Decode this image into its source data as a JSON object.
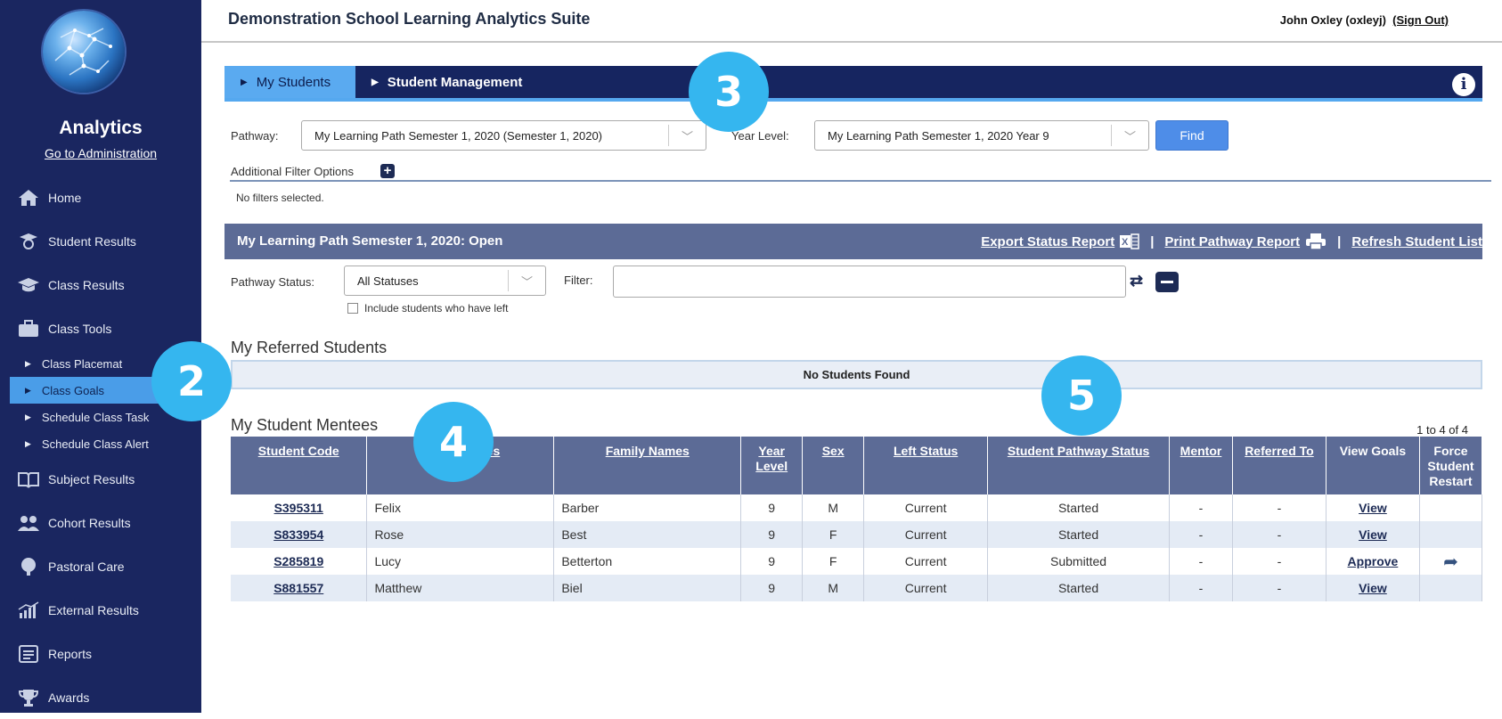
{
  "app": {
    "title": "Demonstration School Learning Analytics Suite",
    "user": "John Oxley (oxleyj)",
    "sign_out": "(Sign Out)"
  },
  "sidebar": {
    "brand": "Analytics",
    "admin_link": "Go to Administration",
    "items": [
      {
        "label": "Home",
        "icon": "home-icon"
      },
      {
        "label": "Student Results",
        "icon": "graduate-icon"
      },
      {
        "label": "Class Results",
        "icon": "mortarboard-icon"
      },
      {
        "label": "Class Tools",
        "icon": "briefcase-icon"
      }
    ],
    "subitems": [
      {
        "label": "Class Placemat"
      },
      {
        "label": "Class Goals"
      },
      {
        "label": "Schedule Class Task"
      },
      {
        "label": "Schedule Class Alert"
      }
    ],
    "items2": [
      {
        "label": "Subject Results",
        "icon": "book-icon"
      },
      {
        "label": "Cohort Results",
        "icon": "group-icon"
      },
      {
        "label": "Pastoral Care",
        "icon": "tree-icon"
      },
      {
        "label": "External Results",
        "icon": "chart-icon"
      },
      {
        "label": "Reports",
        "icon": "report-icon"
      },
      {
        "label": "Awards",
        "icon": "trophy-icon"
      }
    ]
  },
  "tabs": [
    "My Students",
    "Student Management"
  ],
  "filters": {
    "pathway_label": "Pathway:",
    "pathway_value": "My Learning Path Semester 1, 2020 (Semester 1, 2020)",
    "year_label": "Year Level:",
    "year_value": "My Learning Path Semester 1, 2020 Year 9",
    "find": "Find",
    "additional": "Additional Filter Options",
    "none": "No filters selected."
  },
  "pathway": {
    "title": "My Learning Path Semester 1, 2020:  Open",
    "export": "Export Status Report",
    "print": "Print Pathway Report",
    "refresh": "Refresh Student List",
    "status_label": "Pathway Status:",
    "status_value": "All Statuses",
    "filter_label": "Filter:",
    "include_left": "Include students who have left"
  },
  "referred": {
    "heading": "My Referred Students",
    "empty": "No Students Found"
  },
  "mentees": {
    "heading": "My Student Mentees",
    "count": "1 to 4 of 4",
    "columns": [
      "Student Code",
      "Given Names",
      "Family Names",
      "Year Level",
      "Sex",
      "Left Status",
      "Student Pathway Status",
      "Mentor",
      "Referred To",
      "View Goals",
      "Force Student Restart"
    ],
    "rows": [
      [
        "S395311",
        "Felix",
        "Barber",
        "9",
        "M",
        "Current",
        "Started",
        "-",
        "-",
        "View",
        ""
      ],
      [
        "S833954",
        "Rose",
        "Best",
        "9",
        "F",
        "Current",
        "Started",
        "-",
        "-",
        "View",
        ""
      ],
      [
        "S285819",
        "Lucy",
        "Betterton",
        "9",
        "F",
        "Current",
        "Submitted",
        "-",
        "-",
        "Approve",
        "restart"
      ],
      [
        "S881557",
        "Matthew",
        "Biel",
        "9",
        "M",
        "Current",
        "Started",
        "-",
        "-",
        "View",
        ""
      ]
    ]
  },
  "callouts": [
    "2",
    "3",
    "4",
    "5"
  ]
}
